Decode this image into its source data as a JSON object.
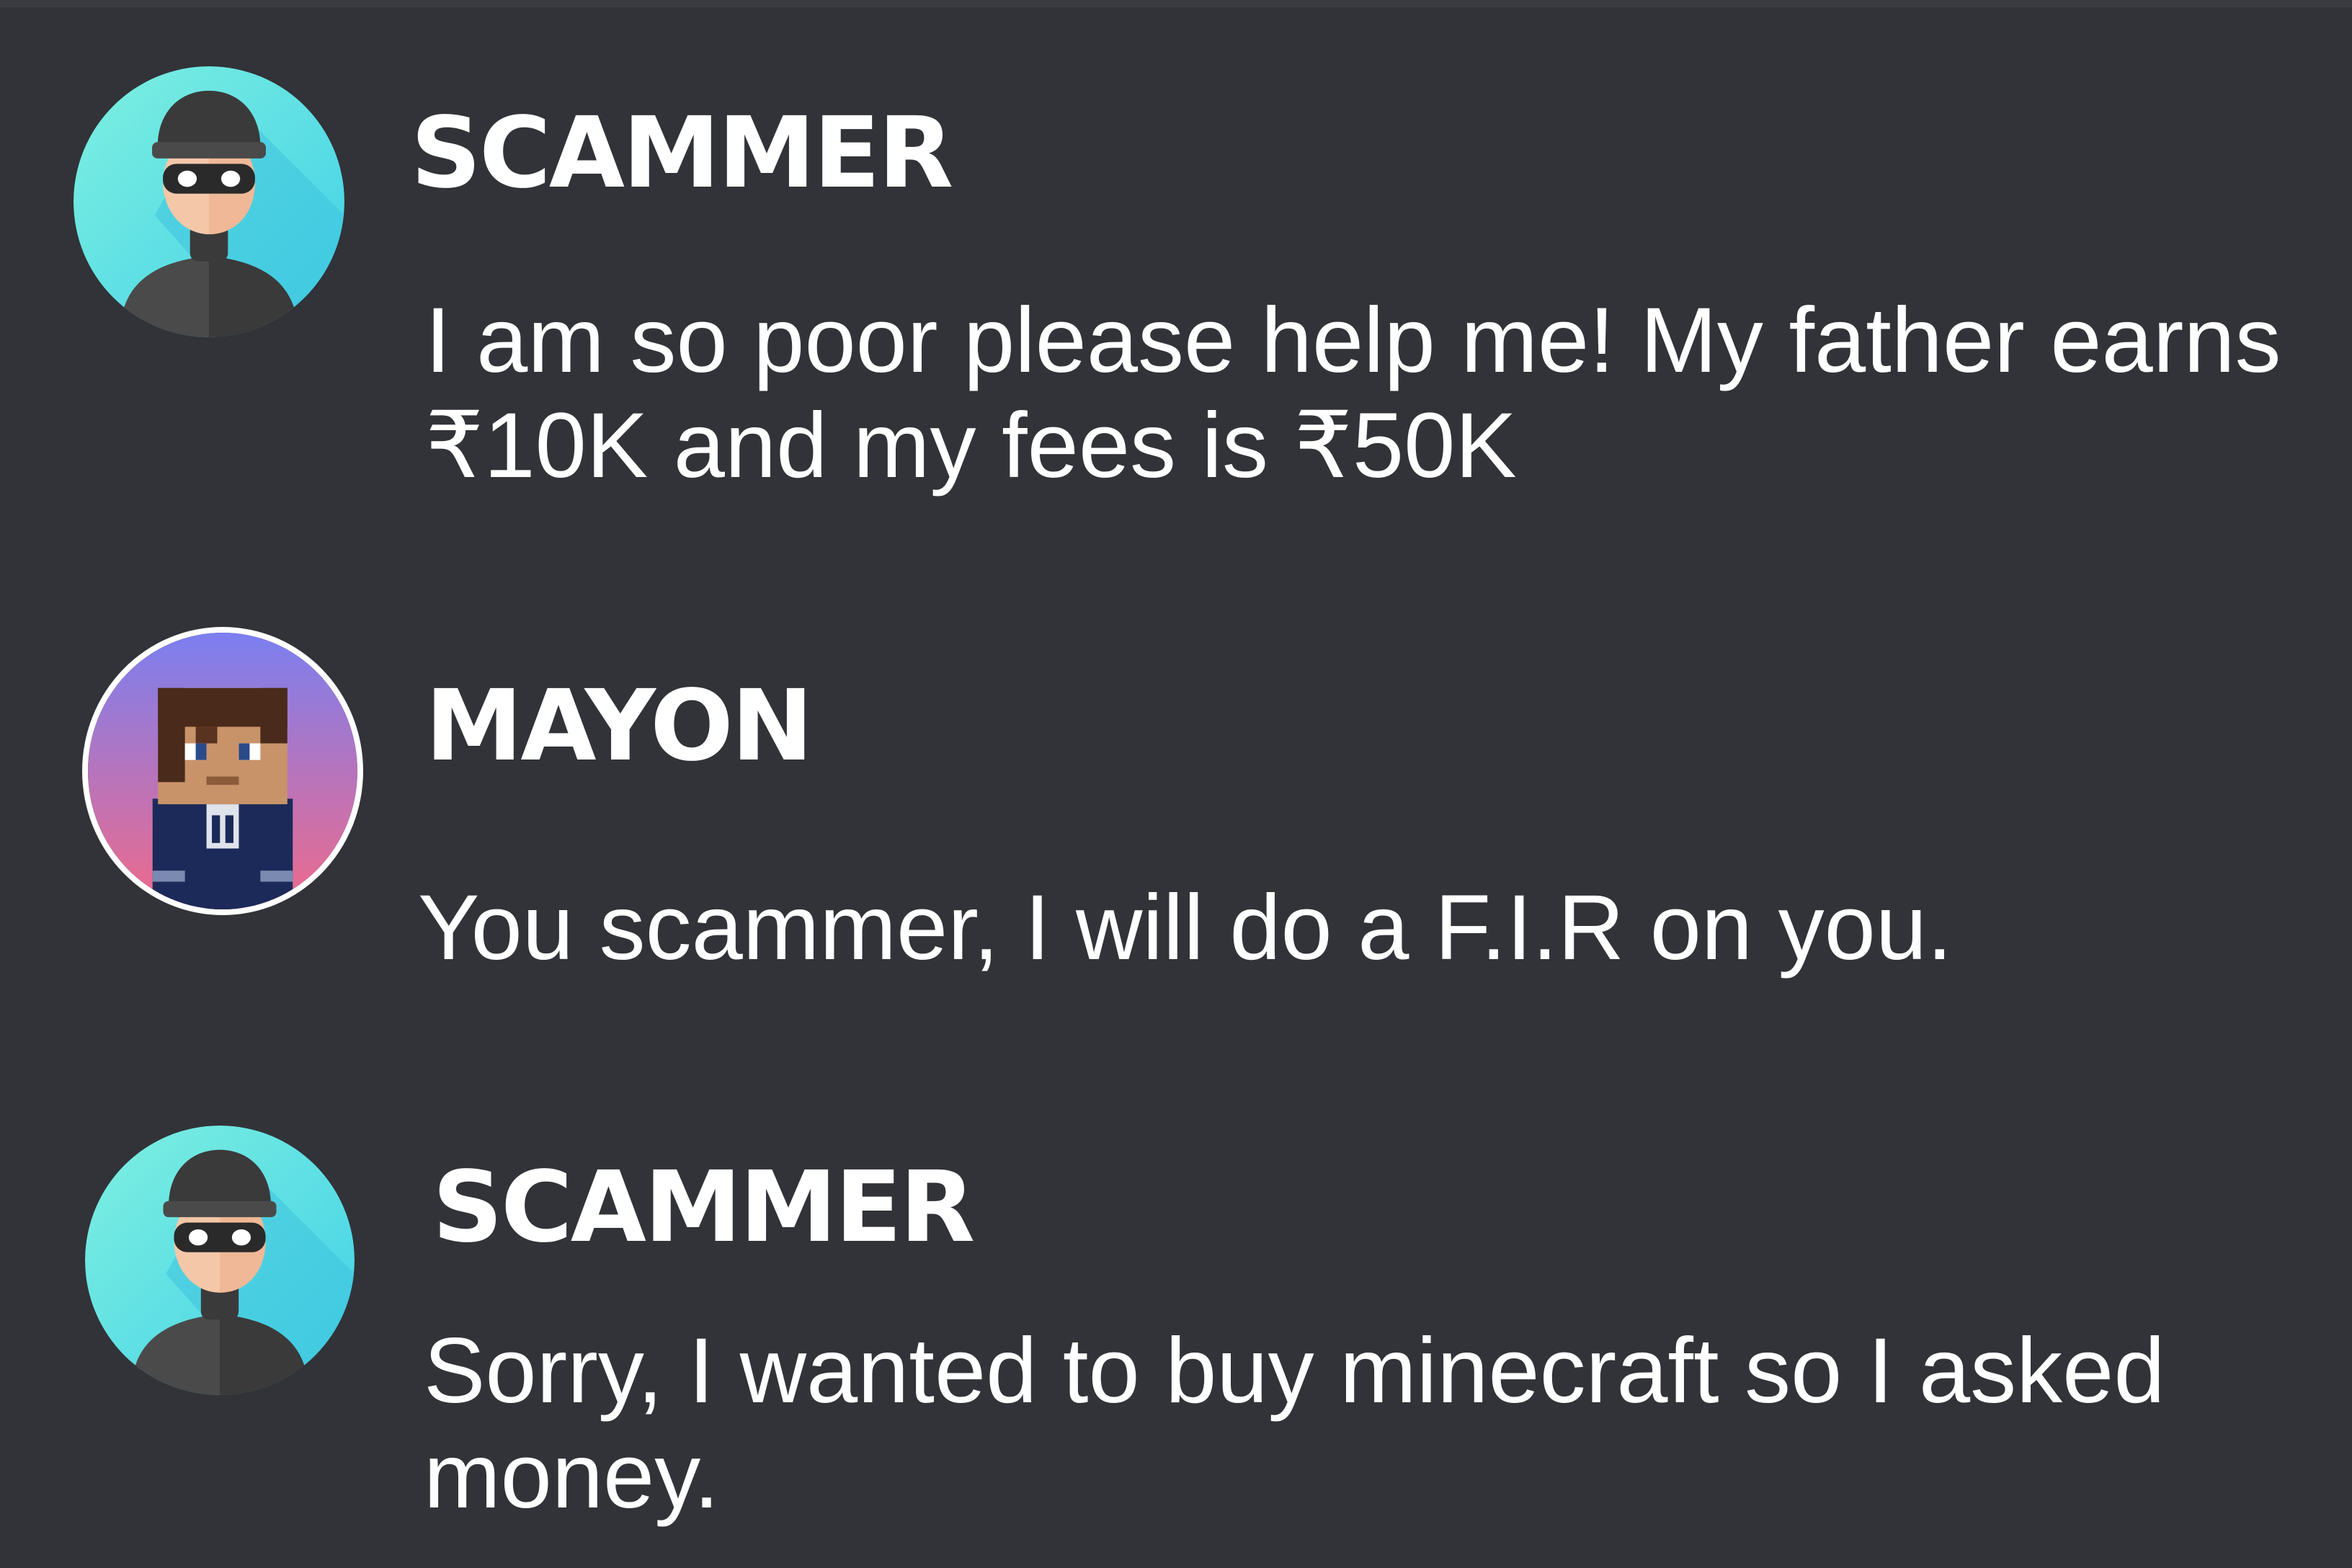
{
  "colors": {
    "background": "#313338",
    "text": "#ffffff",
    "scammer_avatar_bg": "#5fe3e3",
    "mayon_avatar_gradient": [
      "#7b7ff0",
      "#f06a8a"
    ]
  },
  "messages": [
    {
      "author": "SCAMMER",
      "avatar_icon": "burglar-icon",
      "text": "I am so poor please help me! My father earns ₹10K and my fees is ₹50K"
    },
    {
      "author": "MAYON",
      "avatar_icon": "minecraft-skin-icon",
      "text": "You scammer, I will do a F.I.R on you."
    },
    {
      "author": "SCAMMER",
      "avatar_icon": "burglar-icon",
      "text": "Sorry, I wanted to buy minecraft so I asked money."
    }
  ]
}
